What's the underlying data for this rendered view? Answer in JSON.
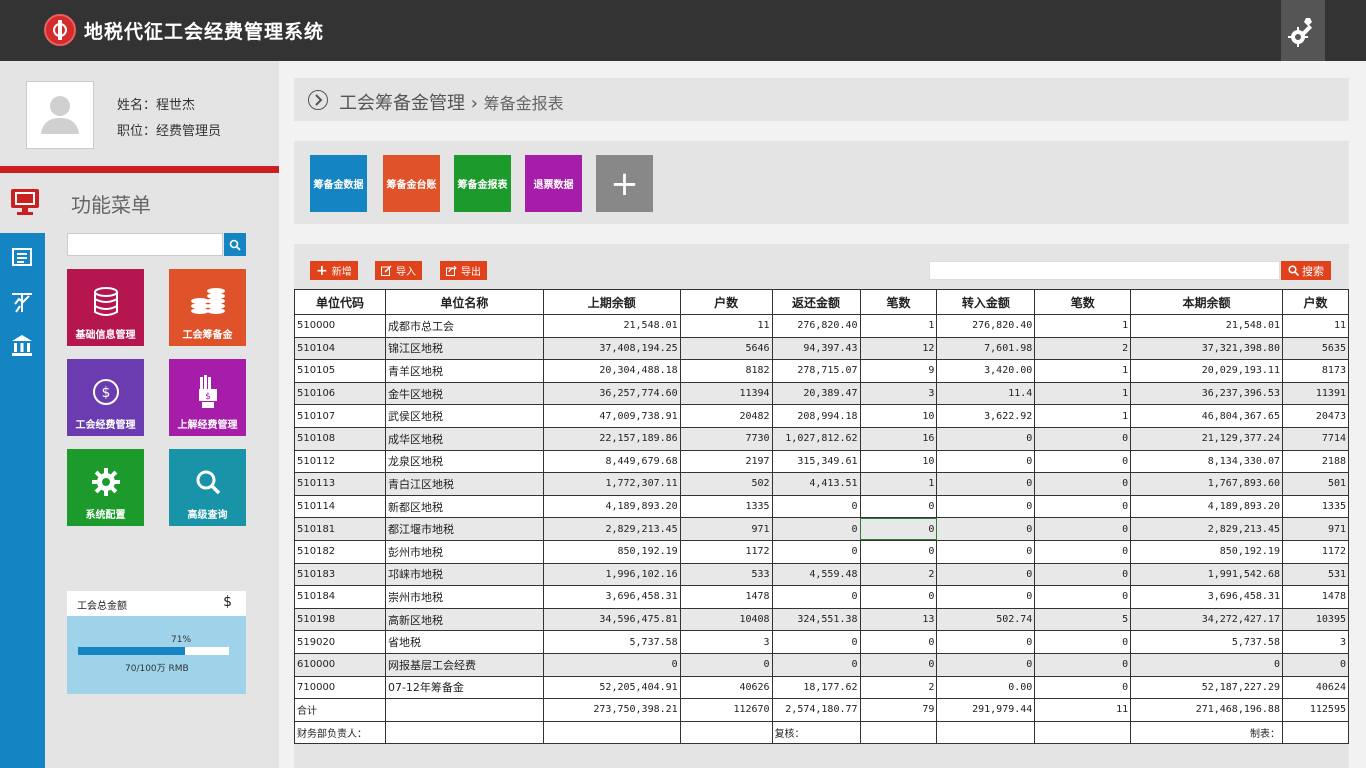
{
  "app": {
    "title": "地税代征工会经费管理系统"
  },
  "user": {
    "name_label": "姓名：程世杰",
    "role_label": "职位：经费管理员"
  },
  "menu": {
    "title": "功能菜单",
    "tiles": [
      {
        "label": "基础信息管理",
        "icon": "database-icon",
        "color": "#b5164f"
      },
      {
        "label": "工会筹备金",
        "icon": "coins-icon",
        "color": "#e0532a"
      },
      {
        "label": "工会经费管理",
        "icon": "dollar-icon",
        "color": "#6b3cb0"
      },
      {
        "label": "上解经费管理",
        "icon": "money-hand-icon",
        "color": "#a51da8"
      },
      {
        "label": "系统配置",
        "icon": "gear-icon",
        "color": "#1c9a2c"
      },
      {
        "label": "高级查询",
        "icon": "search-icon",
        "color": "#1893a8"
      }
    ]
  },
  "fund": {
    "title": "工会总金额",
    "symbol": "$",
    "percent_label": "71%",
    "percent": 0.71,
    "amount": "70/100万 RMB"
  },
  "breadcrumb": {
    "section": "工会筹备金管理",
    "separator": "›",
    "page": "筹备金报表"
  },
  "quick_tiles": [
    {
      "label": "筹备金数据",
      "color": "#1584c2"
    },
    {
      "label": "筹备金台账",
      "color": "#e0532a"
    },
    {
      "label": "筹备金报表",
      "color": "#1c9a2c"
    },
    {
      "label": "退票数据",
      "color": "#a51da8"
    },
    {
      "label": "+",
      "color": "#888888"
    }
  ],
  "actions": {
    "add": "新增",
    "import": "导入",
    "export": "导出",
    "search": "搜索"
  },
  "table": {
    "headers": [
      "单位代码",
      "单位名称",
      "上期余额",
      "户数",
      "返还金额",
      "笔数",
      "转入金额",
      "笔数",
      "本期余额",
      "户数"
    ],
    "rows": [
      [
        "510000",
        "成都市总工会",
        "21,548.01",
        "11",
        "276,820.40",
        "1",
        "276,820.40",
        "1",
        "21,548.01",
        "11"
      ],
      [
        "510104",
        "锦江区地税",
        "37,408,194.25",
        "5646",
        "94,397.43",
        "12",
        "7,601.98",
        "2",
        "37,321,398.80",
        "5635"
      ],
      [
        "510105",
        "青羊区地税",
        "20,304,488.18",
        "8182",
        "278,715.07",
        "9",
        "3,420.00",
        "1",
        "20,029,193.11",
        "8173"
      ],
      [
        "510106",
        "金牛区地税",
        "36,257,774.60",
        "11394",
        "20,389.47",
        "3",
        "11.4",
        "1",
        "36,237,396.53",
        "11391"
      ],
      [
        "510107",
        "武侯区地税",
        "47,009,738.91",
        "20482",
        "208,994.18",
        "10",
        "3,622.92",
        "1",
        "46,804,367.65",
        "20473"
      ],
      [
        "510108",
        "成华区地税",
        "22,157,189.86",
        "7730",
        "1,027,812.62",
        "16",
        "0",
        "0",
        "21,129,377.24",
        "7714"
      ],
      [
        "510112",
        "龙泉区地税",
        "8,449,679.68",
        "2197",
        "315,349.61",
        "10",
        "0",
        "0",
        "8,134,330.07",
        "2188"
      ],
      [
        "510113",
        "青白江区地税",
        "1,772,307.11",
        "502",
        "4,413.51",
        "1",
        "0",
        "0",
        "1,767,893.60",
        "501"
      ],
      [
        "510114",
        "新都区地税",
        "4,189,893.20",
        "1335",
        "0",
        "0",
        "0",
        "0",
        "4,189,893.20",
        "1335"
      ],
      [
        "510181",
        "都江堰市地税",
        "2,829,213.45",
        "971",
        "0",
        "0",
        "0",
        "0",
        "2,829,213.45",
        "971"
      ],
      [
        "510182",
        "彭州市地税",
        "850,192.19",
        "1172",
        "0",
        "0",
        "0",
        "0",
        "850,192.19",
        "1172"
      ],
      [
        "510183",
        "邛崃市地税",
        "1,996,102.16",
        "533",
        "4,559.48",
        "2",
        "0",
        "0",
        "1,991,542.68",
        "531"
      ],
      [
        "510184",
        "崇州市地税",
        "3,696,458.31",
        "1478",
        "0",
        "0",
        "0",
        "0",
        "3,696,458.31",
        "1478"
      ],
      [
        "510198",
        "高新区地税",
        "34,596,475.81",
        "10408",
        "324,551.38",
        "13",
        "502.74",
        "5",
        "34,272,427.17",
        "10395"
      ],
      [
        "519020",
        "省地税",
        "5,737.58",
        "3",
        "0",
        "0",
        "0",
        "0",
        "5,737.58",
        "3"
      ],
      [
        "610000",
        "网报基层工会经费",
        "0",
        "0",
        "0",
        "0",
        "0",
        "0",
        "0",
        "0"
      ],
      [
        "710000",
        "07-12年筹备金",
        "52,205,404.91",
        "40626",
        "18,177.62",
        "2",
        "0.00",
        "0",
        "52,187,227.29",
        "40624"
      ]
    ],
    "total": [
      "合计",
      "",
      "273,750,398.21",
      "112670",
      "2,574,180.77",
      "79",
      "291,979.44",
      "11",
      "271,468,196.88",
      "112595"
    ],
    "footer": {
      "finance_label": "财务部负责人：",
      "review_label": "复核：",
      "maker_label": "制表："
    }
  }
}
